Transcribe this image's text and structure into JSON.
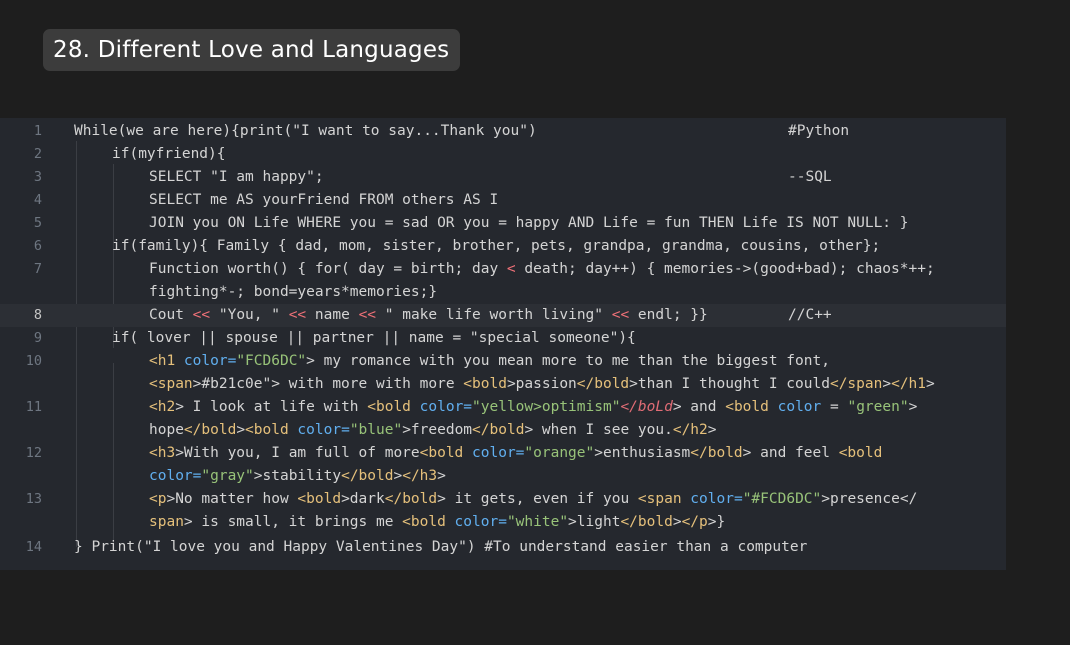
{
  "title": "28.  Different Love and Languages",
  "editor": {
    "line_numbers": [
      "1",
      "2",
      "3",
      "4",
      "5",
      "6",
      "7",
      "8",
      "9",
      "10",
      "11",
      "12",
      "13",
      "14"
    ],
    "active_line": "8",
    "code": {
      "l1": "While(we are here){print(\"I want to say...Thank you\")",
      "l1_comment": "#Python",
      "l2": "if(myfriend){",
      "l3": "SELECT \"I am happy\";",
      "l3_comment": "--SQL",
      "l4": "SELECT me AS yourFriend FROM others AS I",
      "l5": "JOIN you ON Life WHERE you = sad OR you = happy AND Life = fun THEN Life IS NOT NULL: }",
      "l6": "if(family){ Family { dad, mom, sister, brother, pets, grandpa, grandma, cousins, other};",
      "l7a_pre": "Function worth() { for( day = birth; day ",
      "l7a_op": "<",
      "l7a_post": " death; day++) { memories->(good+bad); chaos*++;",
      "l7b": "fighting*-; bond=years*memories;}",
      "l8_cout": "Cout ",
      "l8_op": "<<",
      "l8_s1": " \"You, \" ",
      "l8_s2": " name ",
      "l8_s3": " \" make life worth living\" ",
      "l8_s4": " endl; }}",
      "l8_comment": "//C++",
      "l9": "if( lover || spouse || partner || name = \"special someone\"){",
      "l10a_tag": "<h1",
      "l10a_attr": " color=",
      "l10a_str": "\"FCD6DC\"",
      "l10a_text": "> my romance with you mean more to me than the biggest font,",
      "l10b_span": "<span",
      "l10b_a": ">#b21c0e\"> with more with more ",
      "l10b_bold": "<bold",
      "l10b_b": ">passion",
      "l10b_cbold": "</bold",
      "l10b_c": ">than I thought I could",
      "l10b_cspan": "</span",
      "l10b_d": ">",
      "l10b_ch1": "</h1",
      "l10b_e": ">",
      "l11a_h2": "<h2",
      "l11a_t1": "> I look at life with ",
      "l11a_bold": "<bold",
      "l11a_attr": " color=",
      "l11a_str": "\"yellow>optimism\"",
      "l11a_bad": "</boLd",
      "l11a_t2": "> and ",
      "l11a_bold2": "<bold",
      "l11a_attr2": " color",
      "l11a_t3": " = ",
      "l11a_str2": "\"green\"",
      "l11a_t4": ">",
      "l11b_t1": "hope",
      "l11b_cbold": "</bold",
      "l11b_t2": ">",
      "l11b_bold": "<bold",
      "l11b_attr": " color=",
      "l11b_str": "\"blue\"",
      "l11b_t3": ">freedom",
      "l11b_cbold2": "</bold",
      "l11b_t4": "> when I see you.",
      "l11b_ch2": "</h2",
      "l11b_t5": ">",
      "l12a_h3": "<h3",
      "l12a_t1": ">With you, I am full of more",
      "l12a_bold": "<bold",
      "l12a_attr": " color=",
      "l12a_str": "\"orange\"",
      "l12a_t2": ">enthusiasm",
      "l12a_cbold": "</bold",
      "l12a_t3": "> and feel ",
      "l12a_bold2": "<bold",
      "l12b_attr": "color=",
      "l12b_str": "\"gray\"",
      "l12b_t1": ">stability",
      "l12b_cbold": "</bold",
      "l12b_t2": ">",
      "l12b_ch3": "</h3",
      "l12b_t3": ">",
      "l13a_p": "<p",
      "l13a_t1": ">No matter how ",
      "l13a_bold": "<bold",
      "l13a_t2": ">dark",
      "l13a_cbold": "</bold",
      "l13a_t3": "> it gets, even if you ",
      "l13a_span": "<span",
      "l13a_attr": " color=",
      "l13a_str": "\"#FCD6DC\"",
      "l13a_t4": ">presence</",
      "l13b_span": "span",
      "l13b_t1": "> is small, it brings me ",
      "l13b_bold": "<bold",
      "l13b_attr": " color=",
      "l13b_str": "\"white\"",
      "l13b_t2": ">light",
      "l13b_cbold": "</bold",
      "l13b_t3": ">",
      "l13b_cp": "</p",
      "l13b_t4": ">}",
      "l14": "} Print(\"I love you and Happy Valentines Day\") #To understand easier than a computer"
    }
  }
}
